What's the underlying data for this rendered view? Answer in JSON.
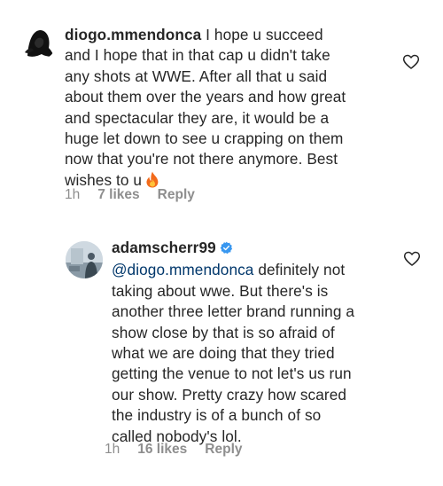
{
  "comments": [
    {
      "username": "diogo.mmendonca",
      "lines": [
        " I hope u succeed",
        "and I hope that in that cap u didn't take",
        "any shots at WWE. After all that u said",
        "about them over the years and how great",
        "and spectacular they are, it would be a",
        "huge let down to see u crapping on them",
        "now that you're not there anymore. Best",
        "wishes to u"
      ],
      "emoji": "fire-icon",
      "time": "1h",
      "likes": "7 likes",
      "reply": "Reply",
      "avatar": "avatar-dark-hair",
      "like_icon": "heart-outline-icon"
    },
    {
      "username": "adamscherr99",
      "verified": true,
      "mention": "@diogo.mmendonca",
      "lines": [
        " definitely not",
        "taking about wwe.  But there's is",
        "another three letter brand running a",
        "show close by that is so afraid of",
        "what we are doing that they tried",
        "getting the venue to not let's us run",
        "our show.  Pretty crazy how scared",
        "the industry is of a bunch of so",
        "called nobody's lol."
      ],
      "time": "1h",
      "likes": "16 likes",
      "reply": "Reply",
      "avatar": "avatar-photo",
      "like_icon": "heart-outline-icon"
    }
  ],
  "colors": {
    "text": "#262626",
    "meta": "#8e8e8e",
    "mention": "#00376b",
    "verified": "#3897f0",
    "fire": "#f26a1b"
  }
}
